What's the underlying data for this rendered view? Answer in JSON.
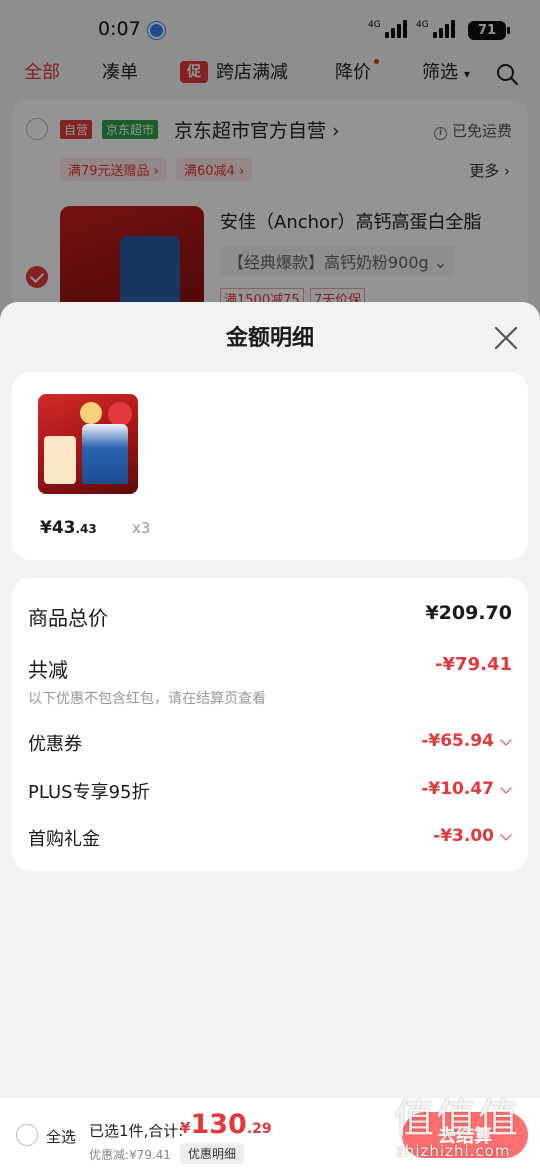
{
  "status_bar": {
    "time": "0:07",
    "net1": "4G",
    "net2": "4G",
    "battery": "71"
  },
  "top_tabs": {
    "all": "全部",
    "bundle": "凑单",
    "promo_badge": "促",
    "cross_store": "跨店满减",
    "price_drop": "降价",
    "filter": "筛选"
  },
  "store": {
    "tag_self": "自营",
    "tag_market": "京东超市",
    "name": "京东超市官方自营",
    "free_shipping": "已免运费",
    "promo1": "满79元送赠品",
    "promo2": "满60减4",
    "more": "更多",
    "product_title": "安佳（Anchor）高钙高蛋白全脂",
    "product_spec": "【经典爆款】高钙奶粉900g",
    "mini_tag1": "满1500减75",
    "mini_tag2": "7天价保"
  },
  "sheet": {
    "title": "金额明细",
    "item_price_main": "¥43",
    "item_price_cents": ".43",
    "item_qty": "x3",
    "total_label": "商品总价",
    "total_value": "¥209.70",
    "reduce_label": "共减",
    "reduce_value": "-¥79.41",
    "note": "以下优惠不包含红包，请在结算页查看",
    "coupon_label": "优惠券",
    "coupon_value": "-¥65.94",
    "plus_label": "PLUS专享95折",
    "plus_value": "-¥10.47",
    "gift_label": "首购礼金",
    "gift_value": "-¥3.00"
  },
  "checkout": {
    "select_all": "全选",
    "selected_summary": "已选1件,合计:",
    "currency": "¥",
    "total_int": "130",
    "total_dec": ".29",
    "saved": "优惠减:¥79.41",
    "detail_button": "优惠明细",
    "checkout_button": "去结算"
  },
  "watermark": {
    "chars": "值值值",
    "domain": "zhizhizhi.com"
  },
  "colors": {
    "accent_red": "#e4393c",
    "market_green": "#2fa34d"
  }
}
